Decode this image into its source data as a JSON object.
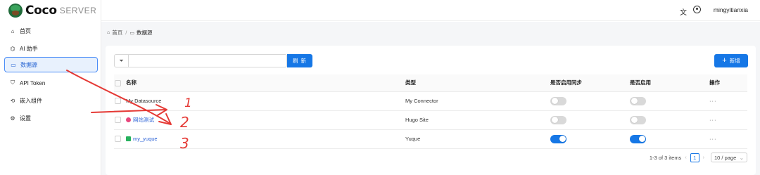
{
  "brand": {
    "name": "Coco",
    "suffix": "SERVER"
  },
  "sidebar": {
    "items": [
      {
        "label": "首页",
        "icon": "home-icon",
        "glyph": "⌂"
      },
      {
        "label": "AI 助手",
        "icon": "robot-icon",
        "glyph": "⌬"
      },
      {
        "label": "数据源",
        "icon": "folder-icon",
        "glyph": "▭",
        "active": true
      },
      {
        "label": "API Token",
        "icon": "shield-icon",
        "glyph": "⛉"
      },
      {
        "label": "嵌入组件",
        "icon": "embed-icon",
        "glyph": "⟲"
      },
      {
        "label": "设置",
        "icon": "gear-icon",
        "glyph": "⚙"
      }
    ]
  },
  "topbar": {
    "language_icon": "translate-icon",
    "language_glyph": "文",
    "username": "mingyitianxia"
  },
  "breadcrumb": {
    "home": "首页",
    "separator": "/",
    "current": "数据源"
  },
  "toolbar": {
    "search_value": "",
    "search_button": "刷 新",
    "add_button": "新增",
    "add_glyph": "+"
  },
  "table": {
    "headers": {
      "name": "名称",
      "type": "类型",
      "sync": "是否启用同步",
      "enabled": "是否启用",
      "actions": "操作"
    },
    "rows": [
      {
        "name": "My Datasource",
        "type": "My Connector",
        "sync_enabled": false,
        "enabled": false,
        "actions": "···",
        "icon": ""
      },
      {
        "name": "网站测试",
        "type": "Hugo Site",
        "sync_enabled": false,
        "enabled": false,
        "actions": "···",
        "icon": "hugo-icon"
      },
      {
        "name": "my_yuque",
        "type": "Yuque",
        "sync_enabled": true,
        "enabled": true,
        "actions": "···",
        "icon": "yuque-icon"
      }
    ]
  },
  "pagination": {
    "summary": "1-3 of 3 items",
    "current_page": "1",
    "page_size": "10 / page",
    "prev": "‹",
    "next": "›",
    "dropdown": "⌄"
  },
  "annotations": {
    "labels": [
      "1",
      "2",
      "3"
    ],
    "color": "#e53935"
  },
  "colors": {
    "accent": "#1677e6",
    "active_bg": "#e8f1fd",
    "annotation_red": "#e53935"
  }
}
